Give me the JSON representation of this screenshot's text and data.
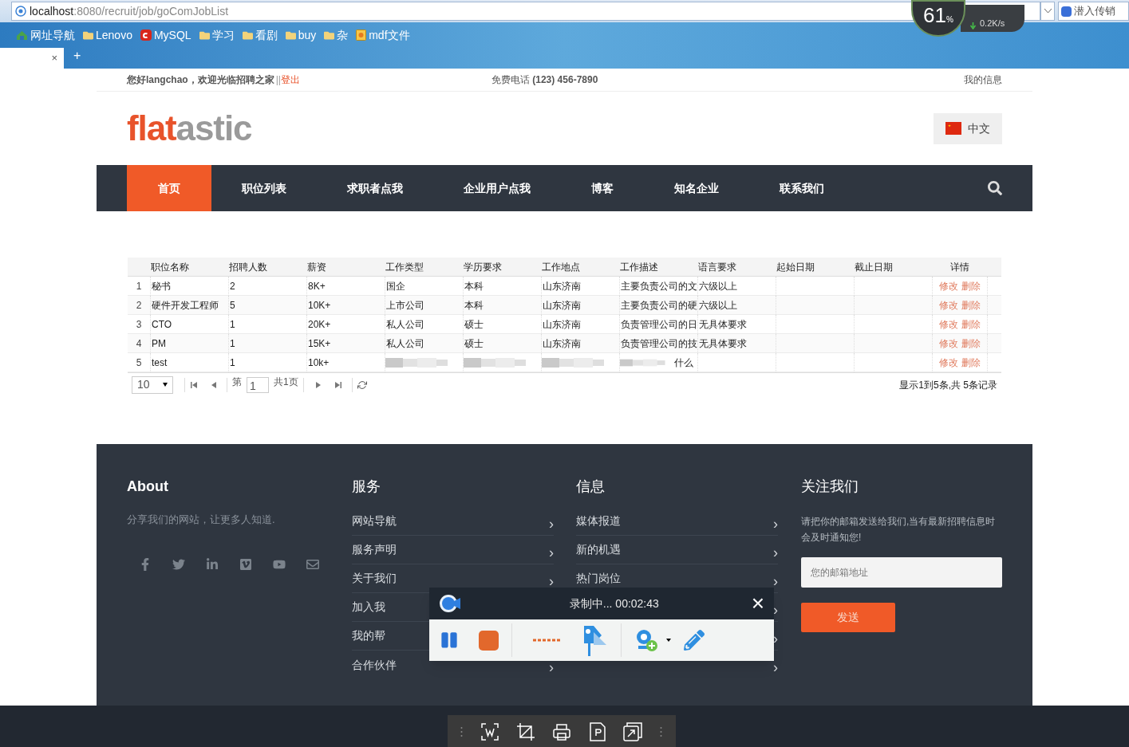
{
  "browser": {
    "address": {
      "host": "localhost",
      "path": ":8080/recruit/job/goComJobList"
    },
    "net_monitor": {
      "cpu": "61",
      "unit": "%",
      "speed": "0.2K/s"
    },
    "search_hint": "潜入传销",
    "bookmarks": [
      {
        "label": "网址导航",
        "kind": "site"
      },
      {
        "label": "Lenovo",
        "kind": "folder"
      },
      {
        "label": "MySQL",
        "kind": "csdn"
      },
      {
        "label": "学习",
        "kind": "folder"
      },
      {
        "label": "看剧",
        "kind": "folder"
      },
      {
        "label": "buy",
        "kind": "folder"
      },
      {
        "label": "杂",
        "kind": "folder"
      },
      {
        "label": "mdf文件",
        "kind": "page"
      }
    ],
    "tab": {
      "close": "×"
    },
    "new_tab": "+"
  },
  "topbar": {
    "greeting": "您好langchao，欢迎光临招聘之家",
    "separator": "||",
    "logout": "登出",
    "phone_label": "免费电话",
    "phone": "(123) 456-7890",
    "my_info": "我的信息"
  },
  "header": {
    "logo": {
      "part1": "flat",
      "part2": "astic"
    },
    "language": "中文"
  },
  "nav": {
    "items": [
      {
        "label": "首页",
        "selected": true
      },
      {
        "label": "职位列表",
        "selected": false
      },
      {
        "label": "求职者点我",
        "selected": false
      },
      {
        "label": "企业用户点我",
        "selected": false
      },
      {
        "label": "博客",
        "selected": false
      },
      {
        "label": "知名企业",
        "selected": false
      },
      {
        "label": "联系我们",
        "selected": false
      }
    ]
  },
  "table": {
    "columns": [
      "职位名称",
      "招聘人数",
      "薪资",
      "工作类型",
      "学历要求",
      "工作地点",
      "工作描述",
      "语言要求",
      "起始日期",
      "截止日期",
      "详情"
    ],
    "rows": [
      {
        "index": "1",
        "cells": [
          {
            "text": "秘书"
          },
          {
            "text": "2"
          },
          {
            "text": "8K+"
          },
          {
            "text": "国企"
          },
          {
            "text": "本科"
          },
          {
            "text": "山东济南"
          },
          {
            "text": "主要负责公司的文"
          },
          {
            "text": "六级以上"
          },
          {
            "kind": "empty"
          },
          {
            "kind": "empty"
          }
        ],
        "actions": [
          "修改",
          "删除"
        ]
      },
      {
        "index": "2",
        "cells": [
          {
            "text": "硬件开发工程师"
          },
          {
            "text": "5"
          },
          {
            "text": "10K+"
          },
          {
            "text": "上市公司"
          },
          {
            "text": "本科"
          },
          {
            "text": "山东济南"
          },
          {
            "text": "主要负责公司的硬"
          },
          {
            "text": "六级以上"
          },
          {
            "kind": "empty"
          },
          {
            "kind": "empty"
          }
        ],
        "actions": [
          "修改",
          "删除"
        ]
      },
      {
        "index": "3",
        "cells": [
          {
            "text": "CTO"
          },
          {
            "text": "1"
          },
          {
            "text": "20K+"
          },
          {
            "text": "私人公司"
          },
          {
            "text": "硕士"
          },
          {
            "text": "山东济南"
          },
          {
            "text": "负责管理公司的日"
          },
          {
            "text": "无具体要求"
          },
          {
            "kind": "empty"
          },
          {
            "kind": "empty"
          }
        ],
        "actions": [
          "修改",
          "删除"
        ]
      },
      {
        "index": "4",
        "cells": [
          {
            "text": "PM"
          },
          {
            "text": "1"
          },
          {
            "text": "15K+"
          },
          {
            "text": "私人公司"
          },
          {
            "text": "硕士"
          },
          {
            "text": "山东济南"
          },
          {
            "text": "负责管理公司的技"
          },
          {
            "text": "无具体要求"
          },
          {
            "kind": "empty"
          },
          {
            "kind": "empty"
          }
        ],
        "actions": [
          "修改",
          "删除"
        ]
      },
      {
        "index": "5",
        "cells": [
          {
            "text": "test"
          },
          {
            "text": "1"
          },
          {
            "text": "10k+"
          },
          {
            "kind": "blurred"
          },
          {
            "kind": "blurred"
          },
          {
            "kind": "blurred"
          },
          {
            "kind": "blurred",
            "text": "什么"
          },
          {
            "kind": "empty"
          },
          {
            "kind": "empty"
          },
          {
            "kind": "empty"
          }
        ],
        "actions": [
          "修改",
          "删除"
        ]
      }
    ]
  },
  "pager": {
    "page_size": "10",
    "page_prefix": "第",
    "page": "1",
    "total_pages": "共1页",
    "summary": "显示1到5条,共 5条记录"
  },
  "footer": {
    "about": {
      "title": "About",
      "text": "分享我们的网站，让更多人知道."
    },
    "services": {
      "title": "服务",
      "items": [
        {
          "label": "网站导航",
          "arrow": "›"
        },
        {
          "label": "服务声明",
          "arrow": "›"
        },
        {
          "label": "关于我们",
          "arrow": "›"
        },
        {
          "label": "加入我"
        },
        {
          "label": "我的帮"
        },
        {
          "label": "合作伙伴",
          "arrow": "›"
        }
      ]
    },
    "info": {
      "title": "信息",
      "items": [
        {
          "label": "媒体报道",
          "arrow": "›"
        },
        {
          "label": "新的机遇",
          "arrow": "›"
        },
        {
          "label": "热门岗位",
          "arrow": "›"
        },
        {
          "arrow": "›"
        },
        {
          "arrow": "›"
        },
        {
          "arrow": "›"
        }
      ]
    },
    "subscribe": {
      "title": "关注我们",
      "text": "请把你的邮箱发送给我们,当有最新招聘信息时会及时通知您!",
      "placeholder": "您的邮箱地址",
      "button": "发送"
    }
  },
  "recorder": {
    "status": "录制中... 00:02:43",
    "close": "×"
  }
}
